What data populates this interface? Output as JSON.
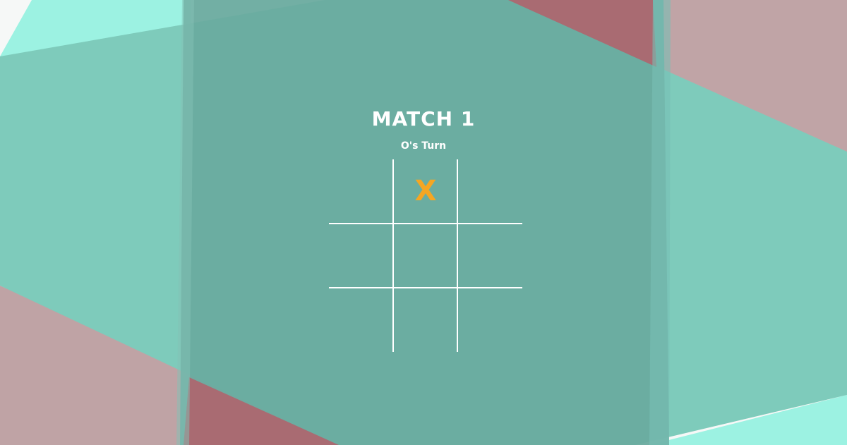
{
  "header": {
    "title": "MATCH 1",
    "turn_text": "O's Turn"
  },
  "board": {
    "cells": [
      "",
      "X",
      "",
      "",
      "",
      "",
      "",
      "",
      ""
    ]
  },
  "colors": {
    "mark_x": "#f5a623",
    "grid_line": "#ffffff",
    "teal": "#7ecbbb",
    "rose": "#b98a8f"
  }
}
